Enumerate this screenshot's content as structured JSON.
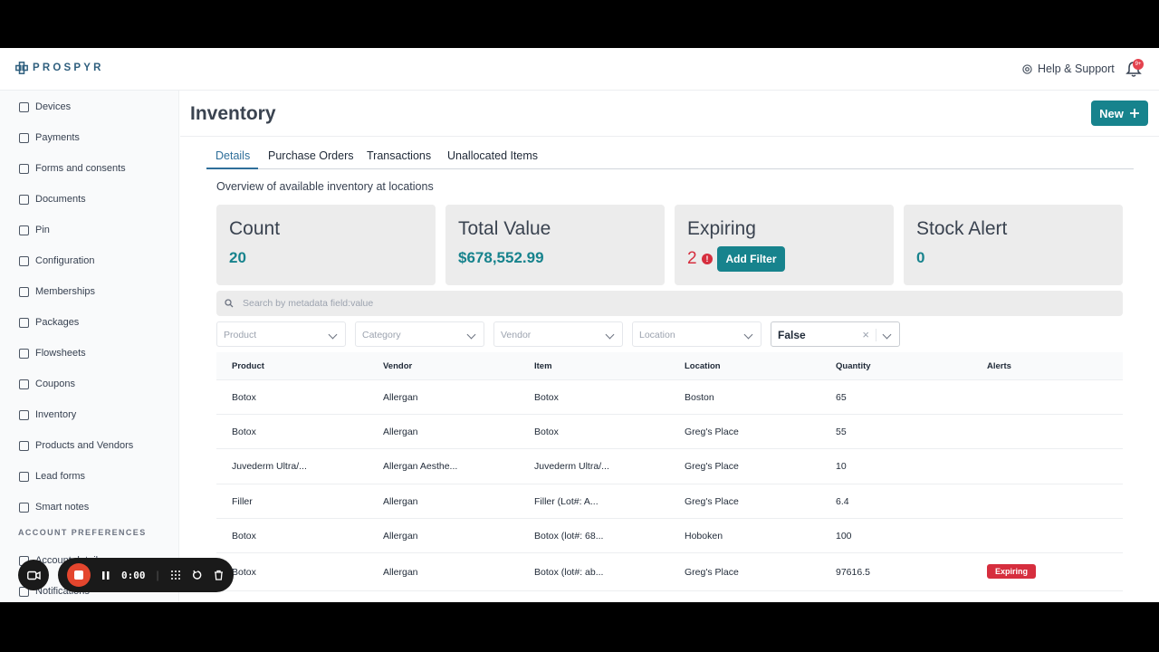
{
  "app": {
    "logo": "PROSPYR",
    "help_label": "Help & Support",
    "notification_count": "9+"
  },
  "sidebar": {
    "items": [
      {
        "label": "Devices",
        "icon": "device-icon"
      },
      {
        "label": "Payments",
        "icon": "card-icon"
      },
      {
        "label": "Forms and consents",
        "icon": "form-icon"
      },
      {
        "label": "Documents",
        "icon": "document-icon"
      },
      {
        "label": "Pin",
        "icon": "keypad-icon"
      },
      {
        "label": "Configuration",
        "icon": "sliders-icon"
      },
      {
        "label": "Memberships",
        "icon": "membership-icon"
      },
      {
        "label": "Packages",
        "icon": "package-icon"
      },
      {
        "label": "Flowsheets",
        "icon": "grid-icon"
      },
      {
        "label": "Coupons",
        "icon": "coupon-icon"
      },
      {
        "label": "Inventory",
        "icon": "inventory-icon"
      },
      {
        "label": "Products and Vendors",
        "icon": "tray-icon"
      },
      {
        "label": "Lead forms",
        "icon": "leadform-icon"
      },
      {
        "label": "Smart notes",
        "icon": "note-icon"
      }
    ],
    "section_label": "ACCOUNT PREFERENCES",
    "pref_items": [
      {
        "label": "Account details"
      },
      {
        "label": "Notifications"
      }
    ]
  },
  "page": {
    "title": "Inventory",
    "new_label": "New",
    "overview": "Overview of available inventory at locations"
  },
  "tabs": [
    "Details",
    "Purchase Orders",
    "Transactions",
    "Unallocated Items"
  ],
  "cards": {
    "count": {
      "title": "Count",
      "value": "20"
    },
    "total": {
      "title": "Total Value",
      "value": "$678,552.99"
    },
    "expiring": {
      "title": "Expiring",
      "value": "2",
      "action": "Add Filter"
    },
    "stock": {
      "title": "Stock Alert",
      "value": "0"
    }
  },
  "search": {
    "placeholder": "Search by metadata field:value"
  },
  "filters": {
    "product": "Product",
    "category": "Category",
    "vendor": "Vendor",
    "location": "Location",
    "status_value": "False"
  },
  "table": {
    "headers": [
      "Product",
      "Vendor",
      "Item",
      "Location",
      "Quantity",
      "Alerts"
    ],
    "rows": [
      [
        "Botox",
        "Allergan",
        "Botox",
        "Boston",
        "65",
        ""
      ],
      [
        "Botox",
        "Allergan",
        "Botox",
        "Greg's Place",
        "55",
        ""
      ],
      [
        "Juvederm Ultra/...",
        "Allergan Aesthe...",
        "Juvederm Ultra/...",
        "Greg's Place",
        "10",
        ""
      ],
      [
        "Filler",
        "Allergan",
        "Filler (Lot#: A...",
        "Greg's Place",
        "6.4",
        ""
      ],
      [
        "Botox",
        "Allergan",
        "Botox (lot#: 68...",
        "Hoboken",
        "100",
        ""
      ],
      [
        "Botox",
        "Allergan",
        "Botox (lot#: ab...",
        "Greg's Place",
        "97616.5",
        "Expiring"
      ]
    ]
  },
  "recorder": {
    "time": "0:00"
  },
  "colors": {
    "primary": "#17838d",
    "danger": "#d62e3e",
    "accent": "#2f6f9a"
  }
}
